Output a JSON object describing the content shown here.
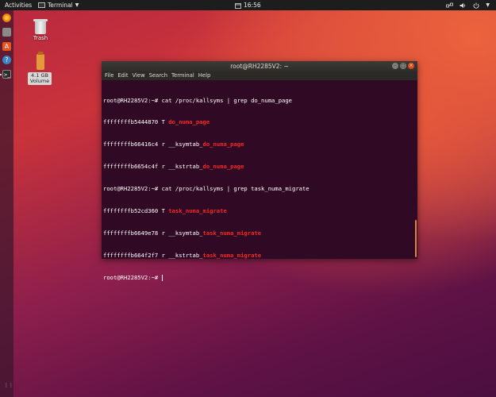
{
  "topbar": {
    "activities": "Activities",
    "app_name": "Terminal",
    "clock": "16:56",
    "tray_icons": [
      "network-icon",
      "volume-icon",
      "power-icon"
    ]
  },
  "dock": {
    "items": [
      {
        "name": "firefox-icon",
        "color": "#e66000"
      },
      {
        "name": "files-icon",
        "color": "#9b9b9b"
      },
      {
        "name": "software-icon",
        "color": "#e95420"
      },
      {
        "name": "help-icon",
        "color": "#3b85c6"
      },
      {
        "name": "terminal-icon",
        "color": "#333333"
      }
    ]
  },
  "desktop": {
    "trash_label": "Trash",
    "volume_label": "4.1 GB Volume"
  },
  "window": {
    "title": "root@RH2285V2: ~",
    "menu": [
      "File",
      "Edit",
      "View",
      "Search",
      "Terminal",
      "Help"
    ]
  },
  "terminal": {
    "lines": [
      {
        "pre": "root@RH2285V2:~# cat /proc/kallsyms | grep do_numa_page",
        "hl": ""
      },
      {
        "pre": "ffffffffb5444870 T ",
        "hl": "do_numa_page"
      },
      {
        "pre": "ffffffffb66416c4 r __ksymtab_",
        "hl": "do_numa_page"
      },
      {
        "pre": "ffffffffb6654c4f r __kstrtab_",
        "hl": "do_numa_page"
      },
      {
        "pre": "root@RH2285V2:~# cat /proc/kallsyms | grep task_numa_migrate",
        "hl": ""
      },
      {
        "pre": "ffffffffb52cd360 T ",
        "hl": "task_numa_migrate"
      },
      {
        "pre": "ffffffffb6649e78 r __ksymtab_",
        "hl": "task_numa_migrate"
      },
      {
        "pre": "ffffffffb664f2f7 r __kstrtab_",
        "hl": "task_numa_migrate"
      },
      {
        "pre": "root@RH2285V2:~# ",
        "hl": ""
      }
    ]
  },
  "colors": {
    "terminal_bg": "#300a24",
    "match_highlight": "#ef2929",
    "accent": "#e95420"
  }
}
